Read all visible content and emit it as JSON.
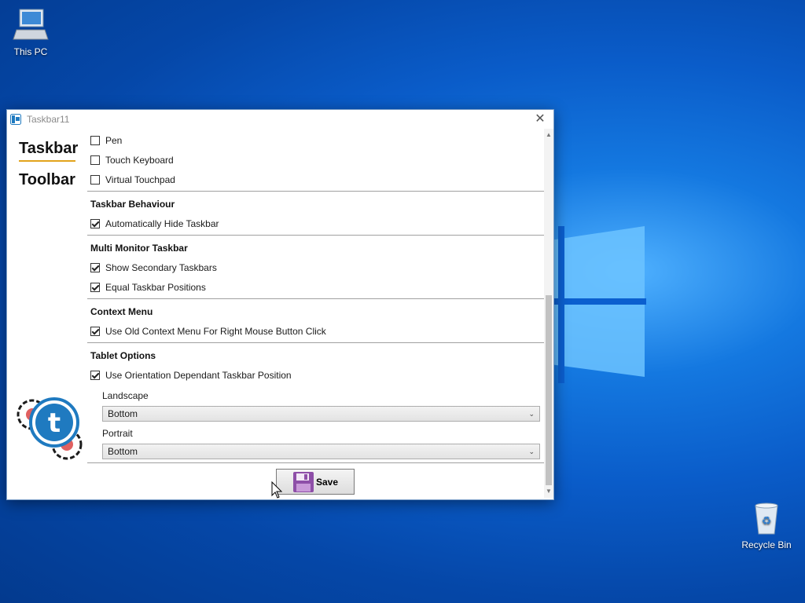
{
  "desktop": {
    "icons": [
      {
        "label": "This PC"
      },
      {
        "label": "Recycle Bin"
      }
    ]
  },
  "window": {
    "title": "Taskbar11",
    "close_glyph": "✕"
  },
  "nav": {
    "items": [
      {
        "label": "Taskbar",
        "selected": true
      },
      {
        "label": "Toolbar",
        "selected": false
      }
    ],
    "accent_color": "#e2a31b"
  },
  "options": {
    "input_items": [
      {
        "label": "Pen",
        "checked": false
      },
      {
        "label": "Touch Keyboard",
        "checked": false
      },
      {
        "label": "Virtual Touchpad",
        "checked": false
      }
    ],
    "sections": [
      {
        "title": "Taskbar Behaviour",
        "items": [
          {
            "label": "Automatically Hide Taskbar",
            "checked": true
          }
        ]
      },
      {
        "title": "Multi Monitor Taskbar",
        "items": [
          {
            "label": "Show Secondary Taskbars",
            "checked": true
          },
          {
            "label": "Equal Taskbar Positions",
            "checked": true
          }
        ]
      },
      {
        "title": "Context Menu",
        "items": [
          {
            "label": "Use Old Context Menu For Right Mouse Button Click",
            "checked": true
          }
        ]
      },
      {
        "title": "Tablet Options",
        "items": [
          {
            "label": "Use Orientation Dependant Taskbar Position",
            "checked": true
          }
        ]
      }
    ],
    "landscape": {
      "label": "Landscape",
      "value": "Bottom"
    },
    "portrait": {
      "label": "Portrait",
      "value": "Bottom"
    }
  },
  "save_button": {
    "label": "Save"
  },
  "icons": {
    "app": "taskbar11-app-icon",
    "gear_logo": "gear-logo-icon",
    "floppy": "floppy-disk-icon",
    "this_pc": "computer-icon",
    "recycle": "recycle-bin-icon"
  }
}
